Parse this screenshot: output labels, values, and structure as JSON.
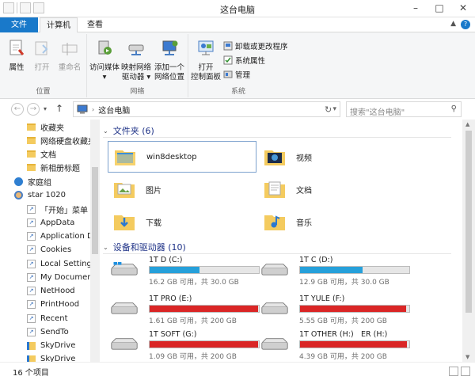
{
  "window": {
    "title": "这台电脑"
  },
  "ribbon_tabs": {
    "file": "文件",
    "computer": "计算机",
    "view": "查看"
  },
  "ribbon": {
    "location_group": {
      "name": "位置",
      "properties": "属性",
      "open": "打开",
      "rename": "重命名"
    },
    "network_group": {
      "name": "网络",
      "access_media": "访问媒体",
      "map_drive_1": "映射网络",
      "map_drive_2": "驱动器",
      "add_location_1": "添加一个",
      "add_location_2": "网络位置"
    },
    "system_group": {
      "name": "系统",
      "open_control_1": "打开",
      "open_control_2": "控制面板",
      "uninstall": "卸载或更改程序",
      "sys_props": "系统属性",
      "manage": "管理"
    }
  },
  "address": {
    "path": "这台电脑",
    "search_placeholder": "搜索\"这台电脑\""
  },
  "nav": {
    "items": [
      {
        "label": "收藏夹",
        "icon": "folder"
      },
      {
        "label": "网络硬盘收藏夹",
        "icon": "folder"
      },
      {
        "label": "文档",
        "icon": "folder"
      },
      {
        "label": "新相册标题",
        "icon": "folder"
      },
      {
        "label": "家庭组",
        "icon": "homegroup"
      },
      {
        "label": "star 1020",
        "icon": "user"
      },
      {
        "label": "「开始」菜单",
        "icon": "shortcut"
      },
      {
        "label": "AppData",
        "icon": "shortcut"
      },
      {
        "label": "Application D",
        "icon": "shortcut"
      },
      {
        "label": "Cookies",
        "icon": "shortcut"
      },
      {
        "label": "Local Settings",
        "icon": "shortcut"
      },
      {
        "label": "My Document",
        "icon": "shortcut"
      },
      {
        "label": "NetHood",
        "icon": "shortcut"
      },
      {
        "label": "PrintHood",
        "icon": "shortcut"
      },
      {
        "label": "Recent",
        "icon": "shortcut"
      },
      {
        "label": "SendTo",
        "icon": "shortcut"
      },
      {
        "label": "SkyDrive",
        "icon": "skydrive"
      },
      {
        "label": "SkyDrive",
        "icon": "skydrive"
      }
    ]
  },
  "folders_section": {
    "title": "文件夹 (6)"
  },
  "folders": [
    {
      "name": "win8desktop",
      "icon": "desktop-folder-icon",
      "selected": true
    },
    {
      "name": "视频",
      "icon": "video-folder-icon"
    },
    {
      "name": "图片",
      "icon": "pictures-folder-icon"
    },
    {
      "name": "文档",
      "icon": "documents-folder-icon"
    },
    {
      "name": "下载",
      "icon": "downloads-folder-icon"
    },
    {
      "name": "音乐",
      "icon": "music-folder-icon"
    }
  ],
  "drives_section": {
    "title": "设备和驱动器 (10)"
  },
  "drives": [
    {
      "name": "1T D (C:)",
      "info": "16.2 GB 可用，共 30.0 GB",
      "used_fraction": 0.46,
      "color": "#26a0da",
      "system": true
    },
    {
      "name": "1T C (D:)",
      "info": "12.9 GB 可用，共 30.0 GB",
      "used_fraction": 0.57,
      "color": "#26a0da",
      "system": false
    },
    {
      "name": "1T PRO (E:)",
      "info": "1.61 GB 可用，共 200 GB",
      "used_fraction": 0.99,
      "color": "#da2626",
      "system": false
    },
    {
      "name": "1T YULE (F:)",
      "info": "5.55 GB 可用，共 200 GB",
      "used_fraction": 0.97,
      "color": "#da2626",
      "system": false
    },
    {
      "name": "1T SOFT (G:)",
      "info": "1.09 GB 可用，共 200 GB",
      "used_fraction": 0.99,
      "color": "#da2626",
      "system": false
    },
    {
      "name": "1T OTHER (H:)",
      "overlap": "ER (H:)",
      "info": "4.39 GB 可用，共 200 GB",
      "used_fraction": 0.98,
      "color": "#da2626",
      "system": false
    }
  ],
  "status": {
    "count": "16 个项目"
  }
}
